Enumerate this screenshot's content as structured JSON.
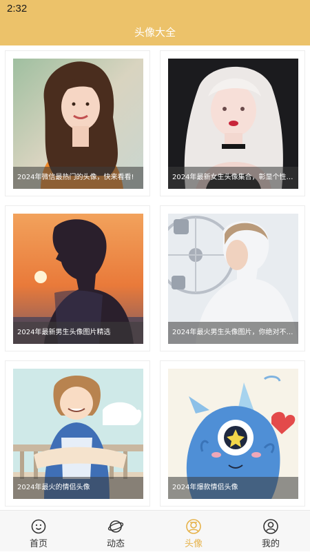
{
  "status_bar": {
    "time": "2:32"
  },
  "header": {
    "title": "头像大全"
  },
  "cards": [
    {
      "caption": "2024年微信最热门的头像，快来看看!",
      "image": "girl-brown-hair-orange-sweater"
    },
    {
      "caption": "2024年最新女生头像集合，彰显个性与…",
      "image": "girl-white-hair"
    },
    {
      "caption": "2024年最新男生头像图片精选",
      "image": "boy-silhouette-sunset"
    },
    {
      "caption": "2024年最火男生头像图片，你绝对不能…",
      "image": "boy-ferris-wheel"
    },
    {
      "caption": "2024年最火的情侣头像",
      "image": "cartoon-boy-balcony"
    },
    {
      "caption": "2024年爆款情侣头像",
      "image": "blue-cartoon-monster"
    }
  ],
  "tabbar": {
    "items": [
      {
        "label": "首页",
        "icon": "home-face-icon"
      },
      {
        "label": "动态",
        "icon": "planet-icon"
      },
      {
        "label": "头像",
        "icon": "avatar-icon"
      },
      {
        "label": "我的",
        "icon": "user-icon"
      }
    ],
    "active_index": 2,
    "active_color": "#e6b24a"
  },
  "colors": {
    "header": "#ecc26a",
    "accent": "#e6b24a"
  }
}
